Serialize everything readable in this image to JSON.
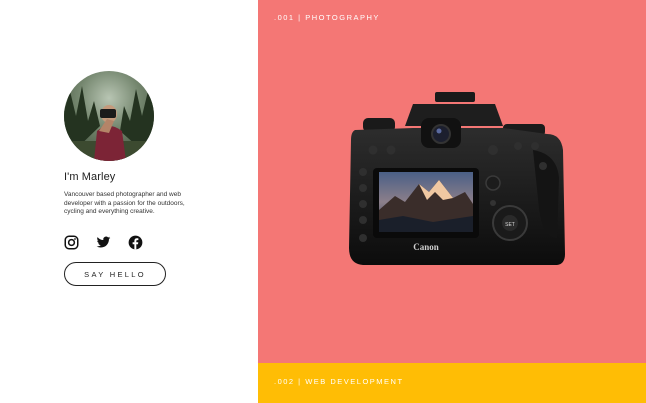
{
  "profile": {
    "name": "I'm Marley",
    "bio": "Vancouver based photographer and web developer with a passion for the outdoors, cycling and everything creative.",
    "cta_label": "SAY HELLO"
  },
  "social_icons": [
    "instagram-icon",
    "twitter-icon",
    "facebook-icon"
  ],
  "panels": {
    "photography": {
      "label": ".001 | PHOTOGRAPHY",
      "color": "#f47775"
    },
    "web_development": {
      "label": ".002 | WEB DEVELOPMENT",
      "color": "#ffbd05"
    }
  },
  "camera": {
    "brand": "Canon",
    "set_button": "SET"
  }
}
